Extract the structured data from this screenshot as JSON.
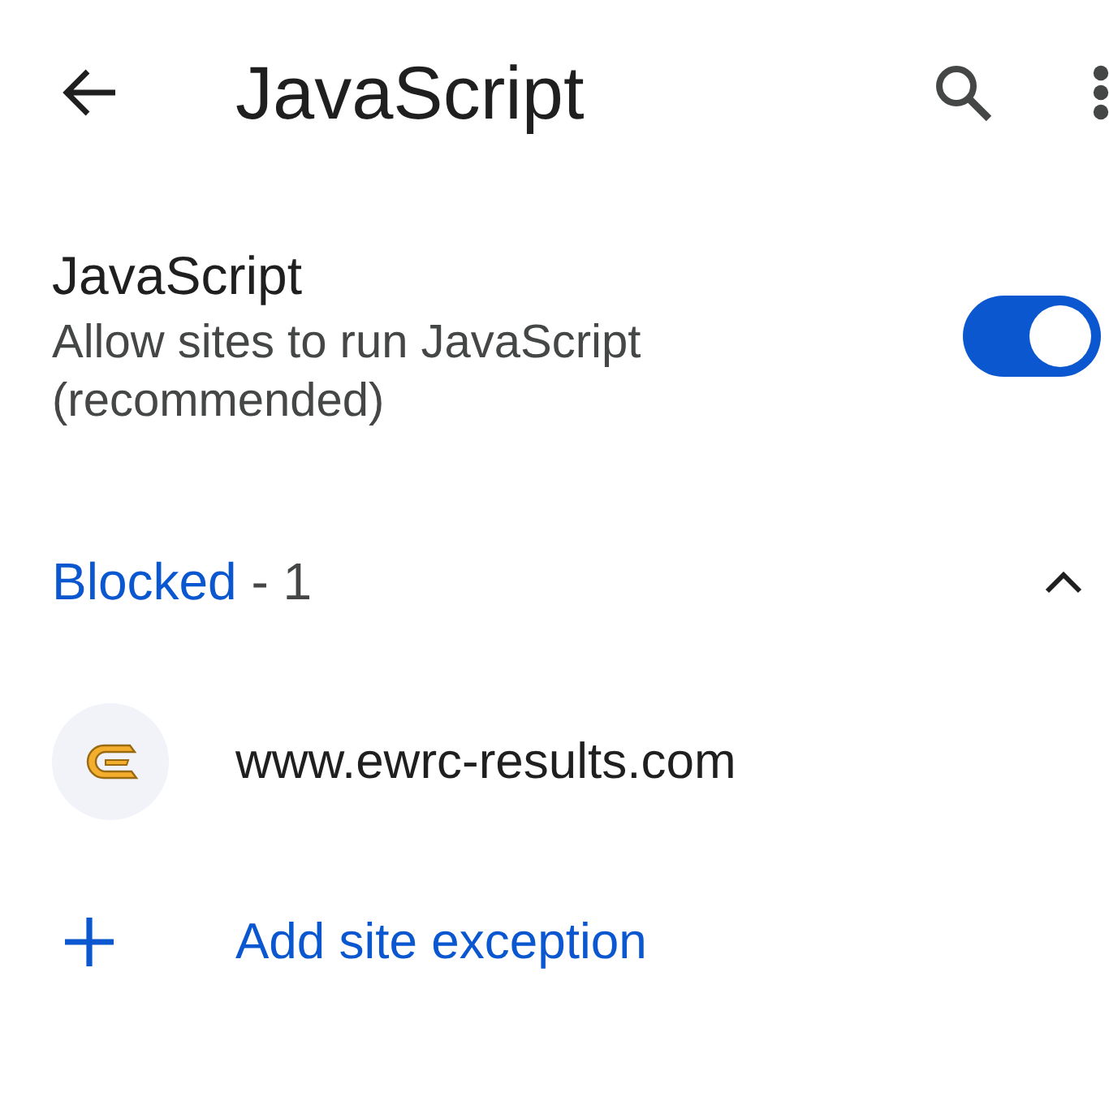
{
  "app_bar": {
    "title": "JavaScript"
  },
  "setting": {
    "title": "JavaScript",
    "description": "Allow sites to run JavaScript (recommended)",
    "on": true
  },
  "section": {
    "label": "Blocked",
    "count": "- 1",
    "expanded": true
  },
  "sites": [
    {
      "url": "www.ewrc-results.com"
    }
  ],
  "add_action": {
    "label": "Add site exception"
  }
}
